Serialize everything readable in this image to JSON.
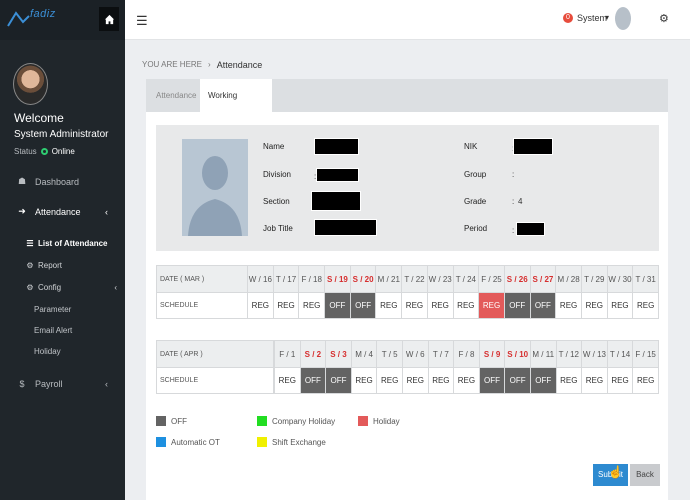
{
  "sidebar": {
    "logo_text": "fadiz",
    "welcome": "Welcome",
    "role": "System Administrator",
    "status_label": "Status",
    "status_value": "Online",
    "nav": {
      "dashboard": "Dashboard",
      "attendance": "Attendance",
      "list_of_attendance": "List of Attendance",
      "report": "Report",
      "config": "Config",
      "parameter": "Parameter",
      "email_alert": "Email Alert",
      "holiday": "Holiday",
      "payroll": "Payroll"
    }
  },
  "topbar": {
    "notification_count": "0",
    "user_label": "System"
  },
  "breadcrumb": {
    "prefix": "YOU ARE HERE",
    "separator": "›",
    "current": "Attendance"
  },
  "tabs": {
    "attendance": "Attendance",
    "working_schedule": "Working Schedule"
  },
  "profile": {
    "name_label": "Name",
    "division_label": "Division",
    "section_label": "Section",
    "job_title_label": "Job Title",
    "nik_label": "NIK",
    "group_label": "Group",
    "grade_label": "Grade",
    "period_label": "Period",
    "colon": ":",
    "grade_value": "4"
  },
  "schedule_mar": {
    "date_label": "DATE ( MAR )",
    "schedule_label": "SCHEDULE",
    "days": [
      "W / 16",
      "T / 17",
      "F / 18",
      "S / 19",
      "S / 20",
      "M / 21",
      "T / 22",
      "W / 23",
      "T / 24",
      "F / 25",
      "S / 26",
      "S / 27",
      "M / 28",
      "T / 29",
      "W / 30",
      "T / 31"
    ],
    "weekend": [
      false,
      false,
      false,
      true,
      true,
      false,
      false,
      false,
      false,
      false,
      true,
      true,
      false,
      false,
      false,
      false
    ],
    "types": [
      "reg",
      "reg",
      "reg",
      "off",
      "off",
      "reg",
      "reg",
      "reg",
      "reg",
      "hol",
      "off",
      "off",
      "reg",
      "reg",
      "reg",
      "reg"
    ],
    "values": [
      "REG",
      "REG",
      "REG",
      "OFF",
      "OFF",
      "REG",
      "REG",
      "REG",
      "REG",
      "REG",
      "OFF",
      "OFF",
      "REG",
      "REG",
      "REG",
      "REG"
    ]
  },
  "schedule_apr": {
    "date_label": "DATE ( APR )",
    "schedule_label": "SCHEDULE",
    "days": [
      "F / 1",
      "S / 2",
      "S / 3",
      "M / 4",
      "T / 5",
      "W / 6",
      "T / 7",
      "F / 8",
      "S / 9",
      "S / 10",
      "M / 11",
      "T / 12",
      "W / 13",
      "T / 14",
      "F / 15"
    ],
    "weekend": [
      false,
      true,
      true,
      false,
      false,
      false,
      false,
      false,
      true,
      true,
      false,
      false,
      false,
      false,
      false
    ],
    "types": [
      "reg",
      "off",
      "off",
      "reg",
      "reg",
      "reg",
      "reg",
      "reg",
      "off",
      "off",
      "off",
      "reg",
      "reg",
      "reg",
      "reg"
    ],
    "values": [
      "REG",
      "OFF",
      "OFF",
      "REG",
      "REG",
      "REG",
      "REG",
      "REG",
      "OFF",
      "OFF",
      "OFF",
      "REG",
      "REG",
      "REG",
      "REG"
    ]
  },
  "legend": [
    {
      "label": "OFF",
      "color": "#636363"
    },
    {
      "label": "Company Holiday",
      "color": "#22dd22"
    },
    {
      "label": "Holiday",
      "color": "#e35a5a"
    },
    {
      "label": "Automatic OT",
      "color": "#1e90e0"
    },
    {
      "label": "Shift Exchange",
      "color": "#f0f000"
    }
  ],
  "buttons": {
    "submit": "Submit",
    "back": "Back"
  },
  "colors": {
    "sidebar_bg": "#20262b",
    "accent": "#2d8ad0",
    "weekend_text": "#d62e2e",
    "off_cell": "#636363",
    "holiday_cell": "#e35a5a",
    "online": "#2ecc71"
  }
}
